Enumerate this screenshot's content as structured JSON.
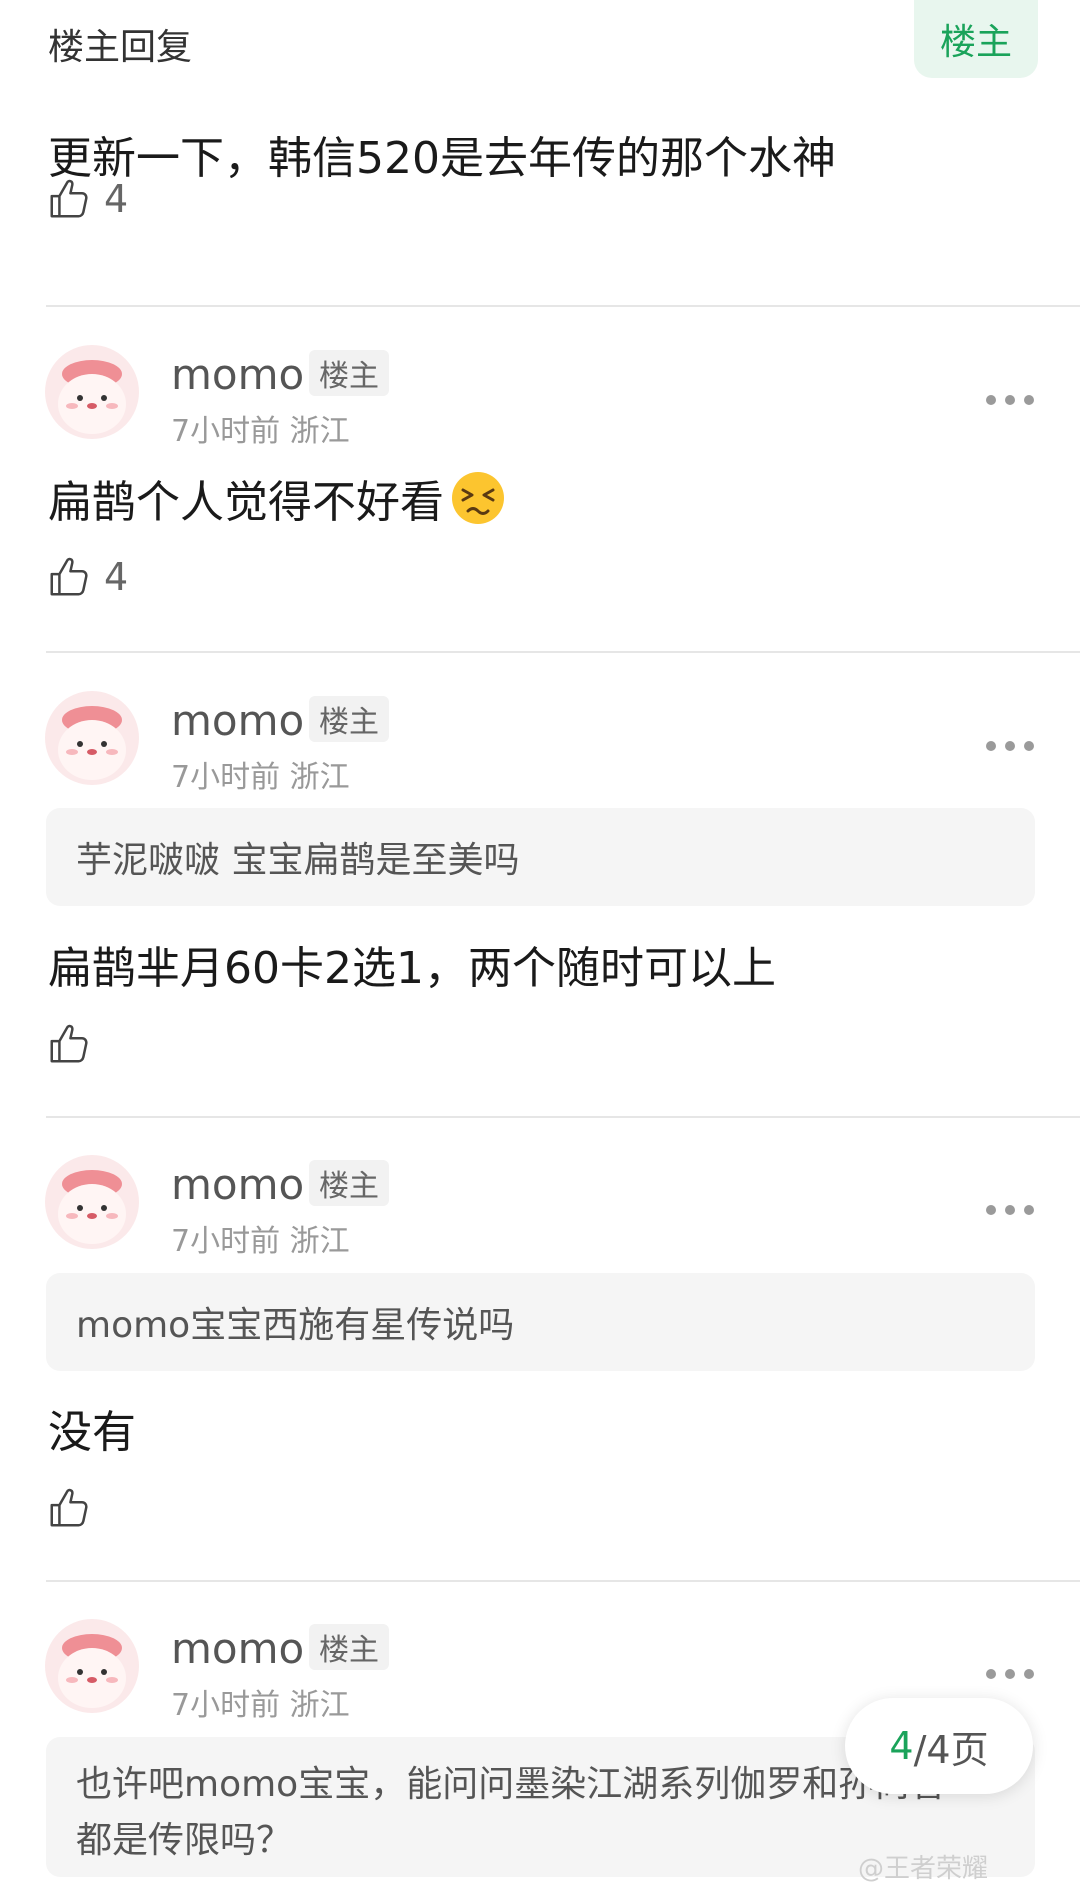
{
  "header": {
    "title": "楼主回复",
    "badge": "楼主"
  },
  "top_post": {
    "content": "更新一下，韩信520是去年传的那个水神",
    "likes": "4"
  },
  "comments": [
    {
      "username": "momo",
      "tag": "楼主",
      "time": "7小时前",
      "location": "浙江",
      "quote": "",
      "content": "扁鹊个人觉得不好看",
      "emoji": "persevering-face",
      "likes": "4"
    },
    {
      "username": "momo",
      "tag": "楼主",
      "time": "7小时前",
      "location": "浙江",
      "quote": "芋泥啵啵 宝宝扁鹊是至美吗",
      "content": "扁鹊芈月60卡2选1，两个随时可以上",
      "likes": ""
    },
    {
      "username": "momo",
      "tag": "楼主",
      "time": "7小时前",
      "location": "浙江",
      "quote": "momo宝宝西施有星传说吗",
      "content": "没有",
      "likes": ""
    },
    {
      "username": "momo",
      "tag": "楼主",
      "time": "7小时前",
      "location": "浙江",
      "quote_line1": "也许吧momo宝宝，能问问墨染江湖系列伽罗和孙尚香",
      "quote_line2": "都是传限吗？"
    }
  ],
  "pager": {
    "current": "4",
    "total": "/4页"
  },
  "watermark": "@王者荣耀"
}
